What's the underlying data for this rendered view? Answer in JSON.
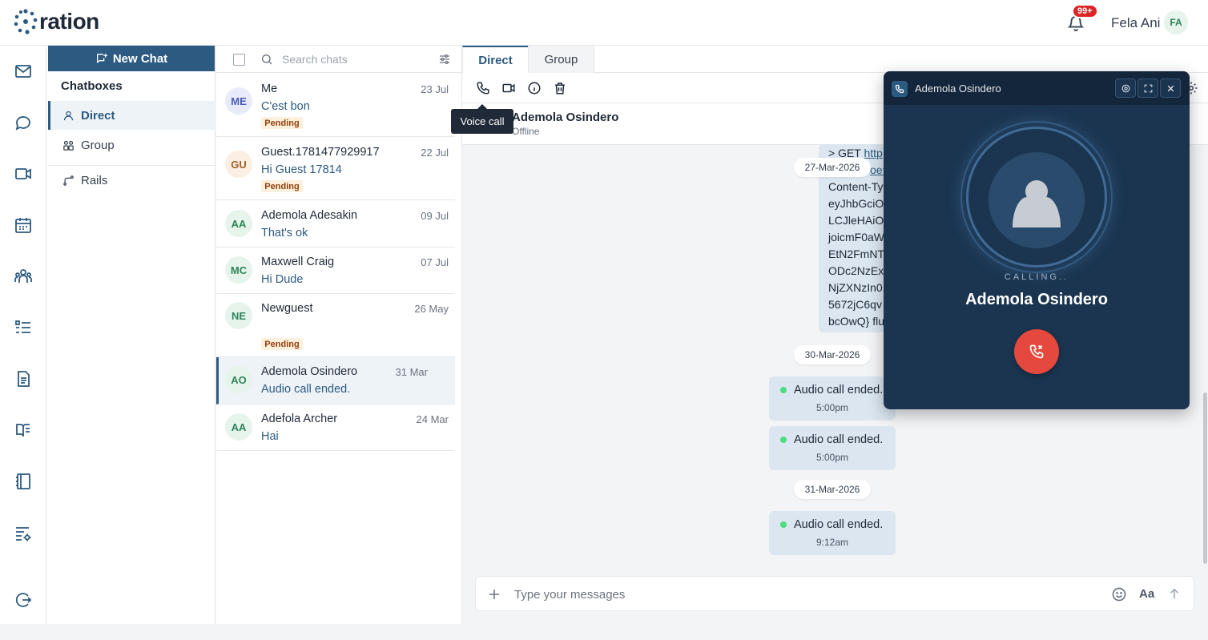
{
  "app": {
    "logo_text": "ration"
  },
  "topbar": {
    "notification_badge": "99+",
    "user_name": "Fela Ani",
    "user_initials": "FA"
  },
  "rail": {
    "icons": [
      "mail-icon",
      "chat-icon",
      "video-icon",
      "calendar-icon",
      "people-icon",
      "list-icon",
      "document-icon",
      "book-open-icon",
      "notebook-icon",
      "settings-list-icon",
      "logout-icon"
    ]
  },
  "chatboxes": {
    "new_chat_label": "New Chat",
    "title": "Chatboxes",
    "items": [
      {
        "label": "Direct",
        "icon": "user-icon",
        "active": true
      },
      {
        "label": "Group",
        "icon": "group-icon",
        "active": false
      },
      {
        "label": "Rails",
        "icon": "rails-icon",
        "active": false
      }
    ]
  },
  "chatlist": {
    "search_placeholder": "Search chats",
    "chats": [
      {
        "initials": "ME",
        "name": "Me",
        "date": "23 Jul",
        "preview": "C'est bon",
        "pending": "Pending",
        "avatar_bg": "#e8ebfa",
        "avatar_fg": "#4c5bb5"
      },
      {
        "initials": "GU",
        "name": "Guest.1781477929917",
        "date": "22 Jul",
        "preview": "Hi Guest 17814",
        "pending": "Pending",
        "avatar_bg": "#fbeee2",
        "avatar_fg": "#a0632c"
      },
      {
        "initials": "AA",
        "name": "Ademola Adesakin",
        "date": "09 Jul",
        "preview": "That's ok",
        "pending": "",
        "avatar_bg": "#e6f4ec",
        "avatar_fg": "#2f855a"
      },
      {
        "initials": "MC",
        "name": "Maxwell Craig",
        "date": "07 Jul",
        "preview": "Hi Dude",
        "pending": "",
        "avatar_bg": "#e6f4ec",
        "avatar_fg": "#2f855a"
      },
      {
        "initials": "NE",
        "name": "Newguest",
        "date": "26 May",
        "preview": "",
        "pending": "Pending",
        "avatar_bg": "#e6f4ec",
        "avatar_fg": "#2f855a"
      },
      {
        "initials": "AO",
        "name": "Ademola Osindero",
        "date": "31 Mar",
        "preview": "Audio call ended.",
        "pending": "",
        "avatar_bg": "#e6f4ec",
        "avatar_fg": "#2f855a"
      },
      {
        "initials": "AA",
        "name": "Adefola Archer",
        "date": "24 Mar",
        "preview": "Hai",
        "pending": "",
        "avatar_bg": "#e6f4ec",
        "avatar_fg": "#2f855a"
      }
    ]
  },
  "main": {
    "tabs": [
      {
        "label": "Direct"
      },
      {
        "label": "Group"
      }
    ],
    "tooltip": "Voice call",
    "contact_name": "Ademola Osindero",
    "contact_status": "Offline",
    "code_lines": [
      "> GET",
      "http",
      "oe=",
      "Content-Ty",
      "eyJhbGciO",
      "LCJleHAiO",
      "joicmF0aW",
      "EtN2FmNT",
      "ODc2NzEx",
      "NjZXNzIn0",
      "5672jC6qv",
      "bcOwQ} flu"
    ],
    "date_pills": [
      "27-Mar-2026",
      "30-Mar-2026",
      "31-Mar-2026"
    ],
    "call_messages": [
      {
        "text": "Audio call ended.",
        "time": "5:00pm"
      },
      {
        "text": "Audio call ended.",
        "time": "5:00pm"
      },
      {
        "text": "Audio call ended.",
        "time": "9:12am"
      }
    ],
    "composer_placeholder": "Type your messages",
    "composer_font_label": "Aa"
  },
  "call_popup": {
    "title": "Ademola Osindero",
    "status": "CALLING..",
    "name": "Ademola Osindero"
  },
  "colors": {
    "primary": "#2c5a80",
    "hangup": "#e5483c",
    "popup_bg": "#1b3550",
    "badge": "#dc2626"
  }
}
